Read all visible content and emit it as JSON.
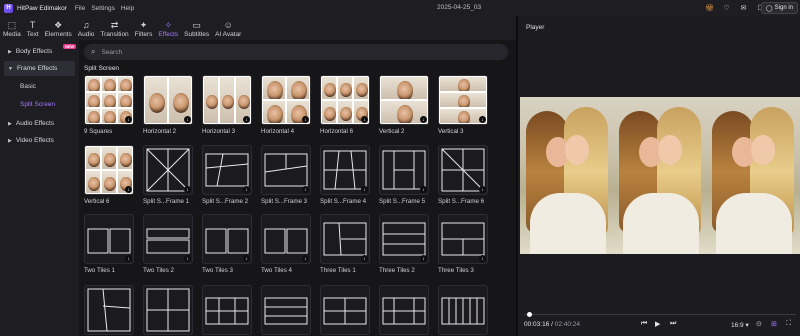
{
  "app": {
    "name": "HitPaw Edimakor",
    "project_title": "2025-04-25_03"
  },
  "menu": [
    "File",
    "Settings",
    "Help"
  ],
  "topbar": {
    "sign_in": "Sign in",
    "icons": [
      "gift-icon",
      "bell-icon",
      "mail-icon",
      "box-icon"
    ]
  },
  "toolbar": [
    {
      "label": "Media",
      "icon": "media-icon"
    },
    {
      "label": "Text",
      "icon": "text-icon"
    },
    {
      "label": "Elements",
      "icon": "elements-icon"
    },
    {
      "label": "Audio",
      "icon": "audio-icon"
    },
    {
      "label": "Transition",
      "icon": "transition-icon"
    },
    {
      "label": "Filters",
      "icon": "filters-icon"
    },
    {
      "label": "Effects",
      "icon": "effects-icon",
      "active": true
    },
    {
      "label": "Subtitles",
      "icon": "subtitles-icon"
    },
    {
      "label": "AI Avatar",
      "icon": "ai-avatar-icon"
    }
  ],
  "sidebar": {
    "items": [
      {
        "label": "Body Effects",
        "badge": "NEW"
      },
      {
        "label": "Frame Effects",
        "expanded": true
      },
      {
        "label": "Audio Effects"
      },
      {
        "label": "Video Effects"
      }
    ],
    "subitems": [
      "Basic",
      "Split Screen"
    ],
    "active_subitem": "Split Screen"
  },
  "search": {
    "placeholder": "Search"
  },
  "section_title": "Split Screen",
  "effects": [
    "9 Squares",
    "Horizontal 2",
    "Horizontal 3",
    "Horizontal 4",
    "Horizontal 6",
    "Vertical 2",
    "Vertical 3",
    "Vertical 6",
    "Split S...Frame 1",
    "Split S...Frame 2",
    "Split S...Frame 3",
    "Split S...Frame 4",
    "Split S...Frame 5",
    "Split S...Frame 6",
    "Two Tiles 1",
    "Two Tiles 2",
    "Two Tiles 3",
    "Two Tiles 4",
    "Three Tiles 1",
    "Three Tiles 2",
    "Three Tiles 3"
  ],
  "player": {
    "label": "Player",
    "current_time": "00:03:16",
    "total_time": "02:40:24",
    "aspect_ratio": "16:9"
  },
  "colors": {
    "accent": "#a478ff",
    "background": "#16161a",
    "panel": "#1d1d22"
  }
}
